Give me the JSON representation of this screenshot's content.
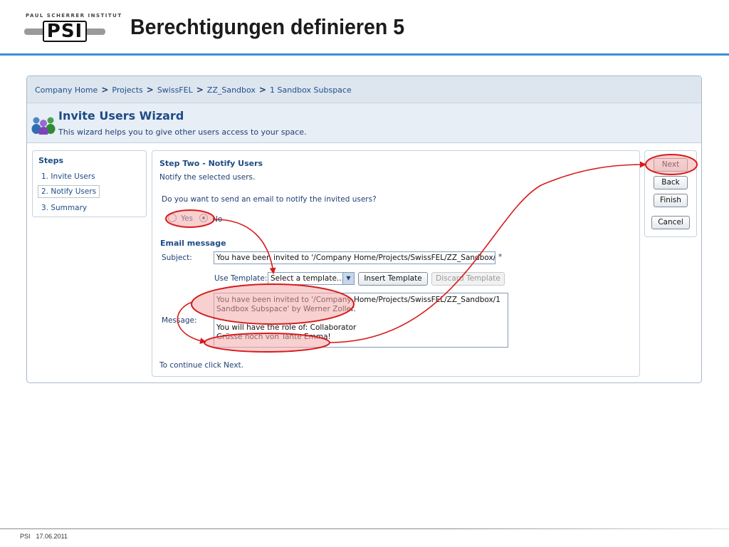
{
  "slide": {
    "title": "Berechtigungen definieren 5",
    "logo_top": "PAUL SCHERRER INSTITUT",
    "logo_mark": "PSI",
    "footer_org": "PSI",
    "footer_date": "17.06.2011"
  },
  "breadcrumb": [
    "Company Home",
    "Projects",
    "SwissFEL",
    "ZZ_Sandbox",
    "1 Sandbox Subspace"
  ],
  "wizard": {
    "title": "Invite Users Wizard",
    "description": "This wizard helps you to give other users access to your space."
  },
  "steps": {
    "title": "Steps",
    "items": [
      "1. Invite Users",
      "2. Notify Users",
      "3. Summary"
    ],
    "active_index": 1
  },
  "main": {
    "heading": "Step Two - Notify Users",
    "subheading": "Notify the selected users.",
    "question": "Do you want to send an email to notify the invited users?",
    "radio_yes": "Yes",
    "radio_no": "No",
    "selected": "No",
    "email_heading": "Email message",
    "subject_label": "Subject:",
    "subject_value": "You have been invited to '/Company Home/Projects/SwissFEL/ZZ_Sandbox/1 Sandbox Subspace'",
    "required_mark": "*",
    "template_label": "Use Template:",
    "template_select": "Select a template...",
    "insert_template": "Insert Template",
    "discard_template": "Discard Template",
    "message_label": "Message:",
    "message_lines": [
      "You have been invited to '/Company Home/Projects/SwissFEL/ZZ_Sandbox/1",
      "Sandbox Subspace' by Werner Zoller.",
      "",
      "You will have the role of: Collaborator",
      "Grüsse noch von Tante Emma!"
    ],
    "continue_hint": "To continue click Next."
  },
  "actions": {
    "next": "Next",
    "back": "Back",
    "finish": "Finish",
    "cancel": "Cancel"
  },
  "colors": {
    "accent_rule": "#3b8fd8",
    "annotation_red": "#d81b1b",
    "annotation_fill": "#f4aaaa",
    "link_blue": "#1e4b86"
  }
}
